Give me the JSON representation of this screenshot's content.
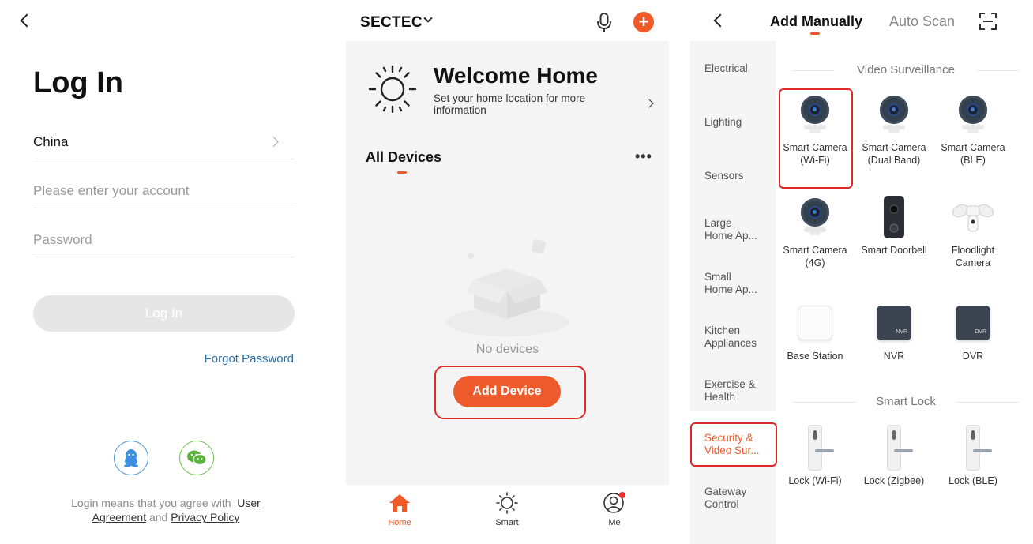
{
  "login": {
    "title": "Log In",
    "country": "China",
    "account_placeholder": "Please enter your account",
    "password_placeholder": "Password",
    "login_button": "Log In",
    "forgot_password": "Forgot Password",
    "agree_prefix": "Login means that you agree with",
    "user_agreement": "User Agreement",
    "agree_and": "and",
    "privacy_policy": "Privacy Policy",
    "social": [
      "qq-icon",
      "wechat-icon"
    ]
  },
  "home": {
    "home_name": "SECTEC",
    "welcome_title": "Welcome Home",
    "welcome_subtitle": "Set your home location for more information",
    "section_title": "All Devices",
    "empty_text": "No devices",
    "add_device_button": "Add Device",
    "tabs": [
      {
        "label": "Home",
        "icon": "home-icon",
        "active": true
      },
      {
        "label": "Smart",
        "icon": "sun-icon",
        "active": false
      },
      {
        "label": "Me",
        "icon": "profile-icon",
        "active": false
      }
    ],
    "accent_color": "#f05a28"
  },
  "add_manually": {
    "tab_manual": "Add Manually",
    "tab_scan": "Auto Scan",
    "categories": [
      "Electrical",
      "Lighting",
      "Sensors",
      "Large Home Ap...",
      "Small Home Ap...",
      "Kitchen Appliances",
      "Exercise & Health",
      "Security & Video Sur...",
      "Gateway Control"
    ],
    "active_category": "Security & Video Sur...",
    "video_section": "Video Surveillance",
    "video_devices": [
      {
        "name": "Smart Camera (Wi-Fi)",
        "icon": "camera-icon"
      },
      {
        "name": "Smart Camera (Dual Band)",
        "icon": "camera-icon"
      },
      {
        "name": "Smart Camera (BLE)",
        "icon": "camera-icon"
      },
      {
        "name": "Smart Camera (4G)",
        "icon": "camera-icon"
      },
      {
        "name": "Smart Doorbell",
        "icon": "doorbell-icon"
      },
      {
        "name": "Floodlight Camera",
        "icon": "floodlight-camera-icon"
      },
      {
        "name": "Base Station",
        "icon": "base-station-icon"
      },
      {
        "name": "NVR",
        "icon": "nvr-icon"
      },
      {
        "name": "DVR",
        "icon": "dvr-icon"
      }
    ],
    "nvr_box_label": "NVR",
    "dvr_box_label": "DVR",
    "lock_section": "Smart Lock",
    "lock_devices": [
      {
        "name": "Lock (Wi-Fi)",
        "icon": "lock-icon"
      },
      {
        "name": "Lock (Zigbee)",
        "icon": "lock-icon"
      },
      {
        "name": "Lock (BLE)",
        "icon": "lock-icon"
      }
    ]
  }
}
